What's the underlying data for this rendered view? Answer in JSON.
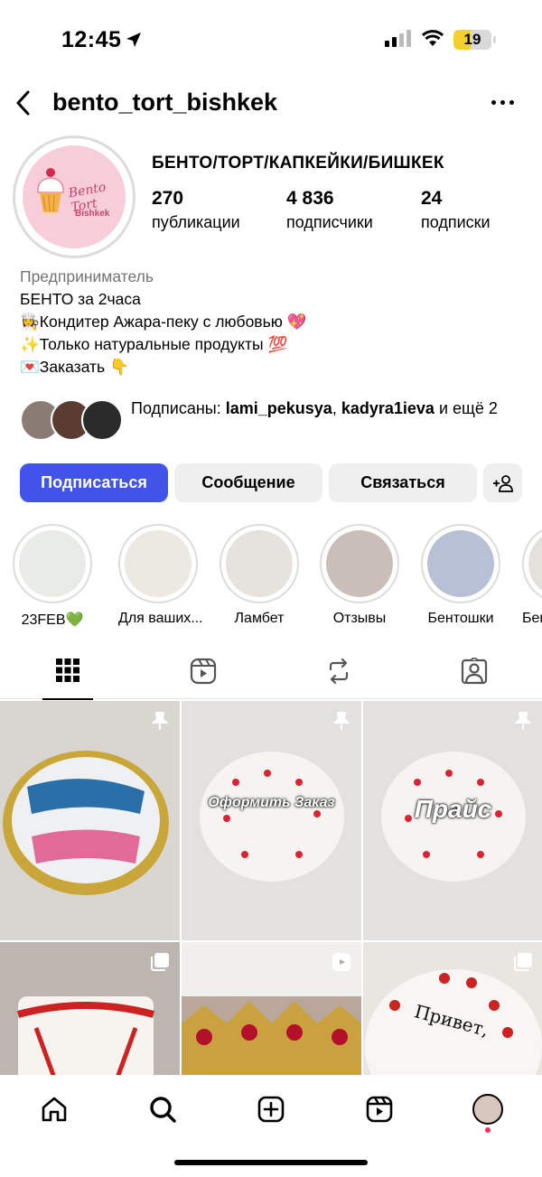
{
  "status_bar": {
    "time": "12:45",
    "battery": "19"
  },
  "header": {
    "username": "bento_tort_bishkek"
  },
  "profile": {
    "avatar_text": "Bento Tort",
    "avatar_sub": "Bishkek",
    "display_name": "БЕНТО/ТОРТ/КАПКЕЙКИ/БИШКЕК",
    "stats": [
      {
        "value": "270",
        "label": "публикации"
      },
      {
        "value": "4 836",
        "label": "подписчики"
      },
      {
        "value": "24",
        "label": "подписки"
      }
    ],
    "category": "Предприниматель",
    "bio": [
      "БЕНТО за 2часа",
      "👩‍🍳Кондитер Ажара-пеку с любовью 💖",
      "✨Только натуральные продукты 💯",
      "💌Заказать 👇"
    ],
    "mutual": {
      "prefix": "Подписаны: ",
      "user1": "lami_pekusya",
      "sep": ", ",
      "user2": "kadyra1ieva",
      "suffix": " и ещё 2"
    }
  },
  "actions": {
    "follow": "Подписаться",
    "message": "Сообщение",
    "contact": "Связаться"
  },
  "highlights": [
    {
      "label": "23FEB💚",
      "color": "#e9ece6"
    },
    {
      "label": "Для ваших...",
      "color": "#ece8e2"
    },
    {
      "label": "Ламбет",
      "color": "#e6e2de"
    },
    {
      "label": "Отзывы",
      "color": "#c9bfb8"
    },
    {
      "label": "Бентошки",
      "color": "#b7c0d4"
    },
    {
      "label": "Бен",
      "color": "#e4e0dc"
    }
  ],
  "tabs": [
    "grid-icon",
    "reels-icon",
    "reposts-icon",
    "tagged-icon"
  ],
  "grid": [
    {
      "overlay": "",
      "badge": "pin-icon",
      "color": "#d9d6d2"
    },
    {
      "overlay": "Оформить Заказ",
      "badge": "pin-icon",
      "color": "#e3e1df"
    },
    {
      "overlay": "Прайс",
      "badge": "pin-icon",
      "color": "#e3e1df"
    },
    {
      "overlay": "",
      "badge": "carousel-icon",
      "color": "#c8c2bd"
    },
    {
      "overlay": "",
      "badge": "reels-icon",
      "color": "#b9a79b"
    },
    {
      "overlay": "",
      "badge": "carousel-icon",
      "color": "#e9e6e1"
    }
  ],
  "bottom_nav": [
    "home-icon",
    "search-icon",
    "create-icon",
    "reels-icon",
    "profile-avatar"
  ]
}
